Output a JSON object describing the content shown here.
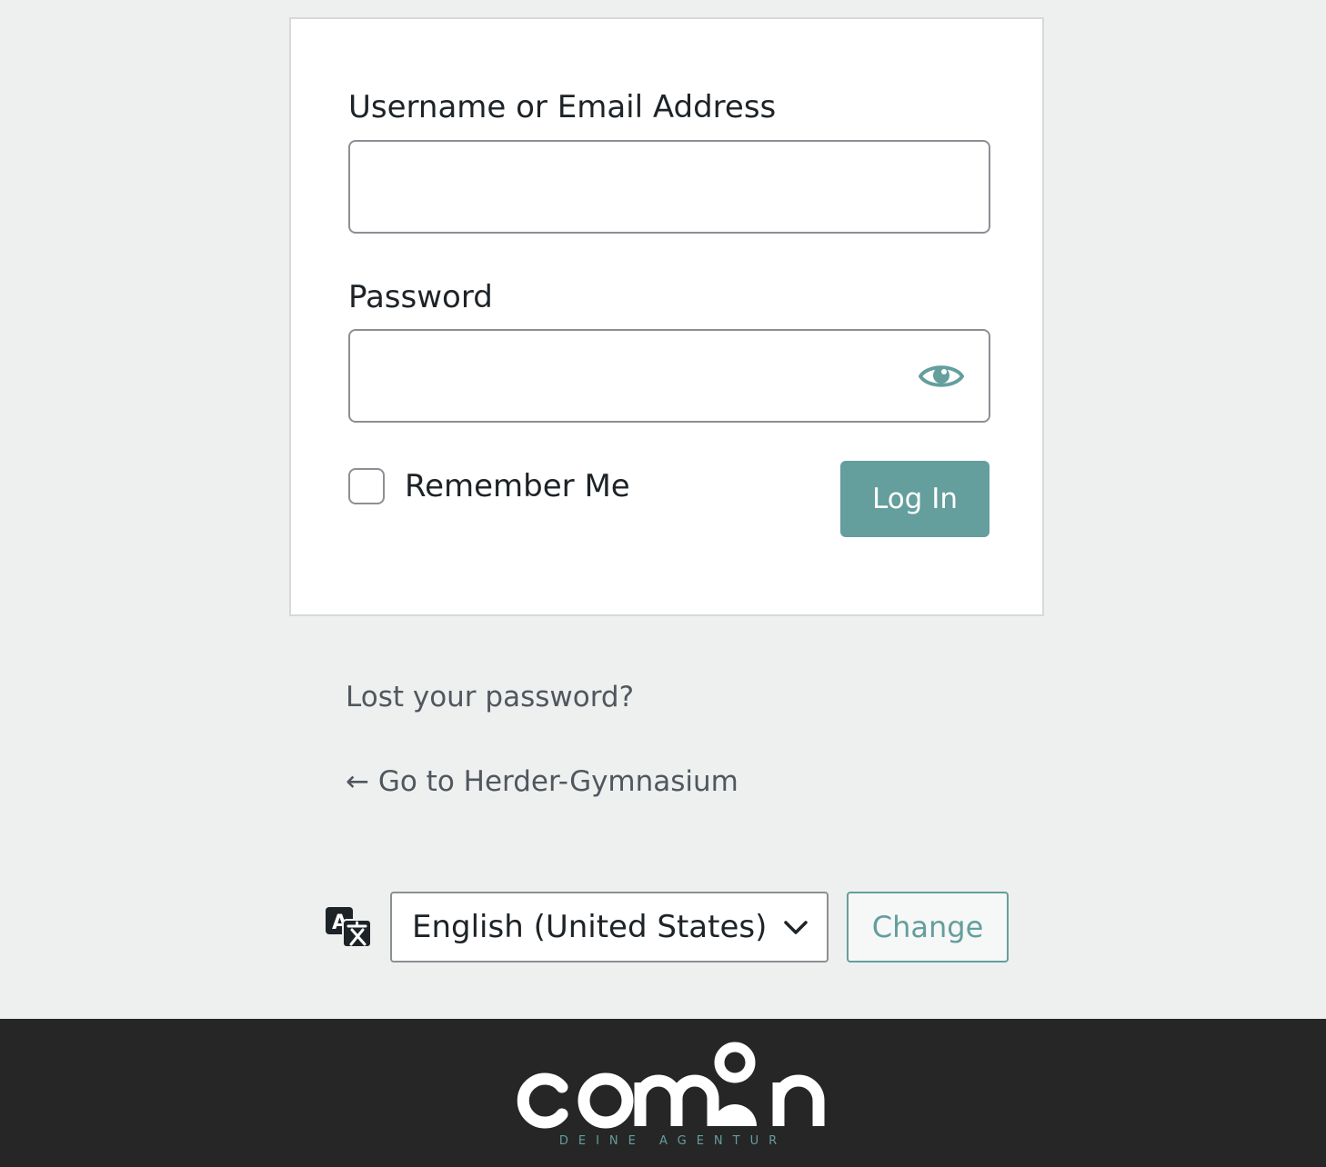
{
  "login_form": {
    "username_label": "Username or Email Address",
    "username_value": "",
    "password_label": "Password",
    "password_value": "",
    "show_password_icon": "eye-icon",
    "remember_label": "Remember Me",
    "remember_checked": false,
    "login_button_label": "Log In"
  },
  "links": {
    "lost_password": "Lost your password?",
    "back_to_site": "← Go to Herder-Gymnasium"
  },
  "language": {
    "icon": "translate-icon",
    "selected": "English (United States)",
    "change_button_label": "Change"
  },
  "footer": {
    "brand": "comon",
    "tagline": "DEINE AGENTUR"
  },
  "colors": {
    "accent": "#649e9d",
    "footer_bg": "#262626",
    "page_bg": "#eef0ef"
  }
}
